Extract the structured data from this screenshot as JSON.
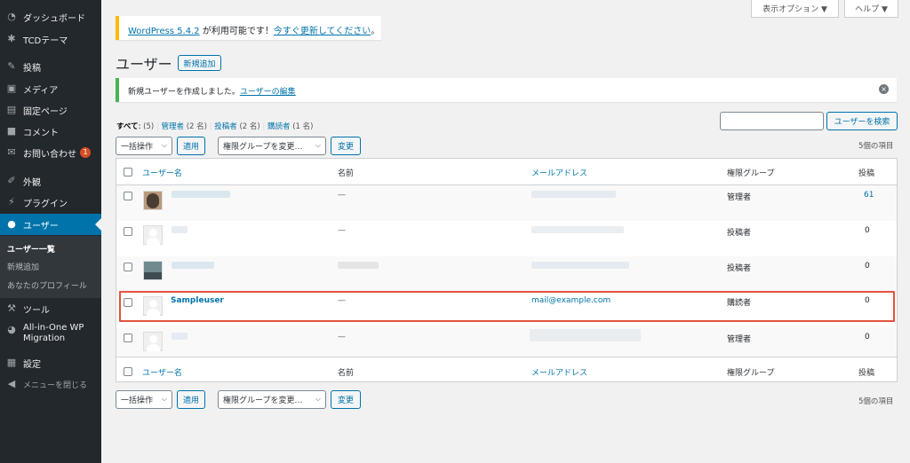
{
  "sidebar": {
    "items": [
      {
        "label": "ダッシュボード",
        "icon": "dashboard-icon"
      },
      {
        "label": "TCDテーマ",
        "icon": "gear-icon"
      },
      {
        "label": "投稿",
        "icon": "pin-icon"
      },
      {
        "label": "メディア",
        "icon": "media-icon"
      },
      {
        "label": "固定ページ",
        "icon": "page-icon"
      },
      {
        "label": "コメント",
        "icon": "comment-icon"
      },
      {
        "label": "お問い合わせ",
        "icon": "mail-icon",
        "badge": "1"
      },
      {
        "label": "外観",
        "icon": "brush-icon"
      },
      {
        "label": "プラグイン",
        "icon": "plugin-icon"
      },
      {
        "label": "ユーザー",
        "icon": "user-icon"
      },
      {
        "label": "ツール",
        "icon": "wrench-icon"
      },
      {
        "label": "All-in-One WP Migration",
        "icon": "migration-icon"
      },
      {
        "label": "設定",
        "icon": "settings-icon"
      },
      {
        "label": "メニューを閉じる",
        "icon": "collapse-icon"
      }
    ],
    "submenu": [
      "ユーザー一覧",
      "新規追加",
      "あなたのプロフィール"
    ]
  },
  "screen_options": {
    "label": "表示オプション ▼",
    "help": "ヘルプ ▼"
  },
  "update_notice": {
    "link": "WordPress 5.4.2",
    "mid": " が利用可能です！",
    "link2": "今すぐ更新してください",
    "end": "。"
  },
  "page_title": "ユーザー",
  "add_new": "新規追加",
  "created_notice": {
    "text": "新規ユーザーを作成しました。",
    "link": "ユーザーの編集"
  },
  "filters": {
    "all_label": "すべて",
    "all_count": "(5)",
    "admin_label": "管理者",
    "admin_count": "(2 名)",
    "author_label": "投稿者",
    "author_count": "(2 名)",
    "sub_label": "購読者",
    "sub_count": "(1 名)"
  },
  "search": {
    "button": "ユーザーを検索",
    "placeholder": ""
  },
  "bulk": {
    "select": "一括操作",
    "apply": "適用",
    "role_select": "権限グループを変更…",
    "change": "変更",
    "count": "5個の項目"
  },
  "table": {
    "headers": {
      "username": "ユーザー名",
      "name": "名前",
      "email": "メールアドレス",
      "role": "権限グループ",
      "posts": "投稿"
    },
    "rows": [
      {
        "username": "",
        "name": "",
        "email": "",
        "role": "管理者",
        "posts": "61"
      },
      {
        "username": "",
        "name": "—",
        "email": "",
        "role": "投稿者",
        "posts": "0"
      },
      {
        "username": "",
        "name": "",
        "email": "",
        "role": "投稿者",
        "posts": "0"
      },
      {
        "username": "Sampleuser",
        "name": "—",
        "email": "mail@example.com",
        "role": "購読者",
        "posts": "0"
      },
      {
        "username": "",
        "name": "—",
        "email": "",
        "role": "管理者",
        "posts": "0"
      }
    ],
    "row0_name": "—"
  },
  "colors": {
    "sidebar": "#23282d",
    "accent": "#0073aa",
    "highlight": "#e2523f",
    "badge": "#d54e21"
  }
}
